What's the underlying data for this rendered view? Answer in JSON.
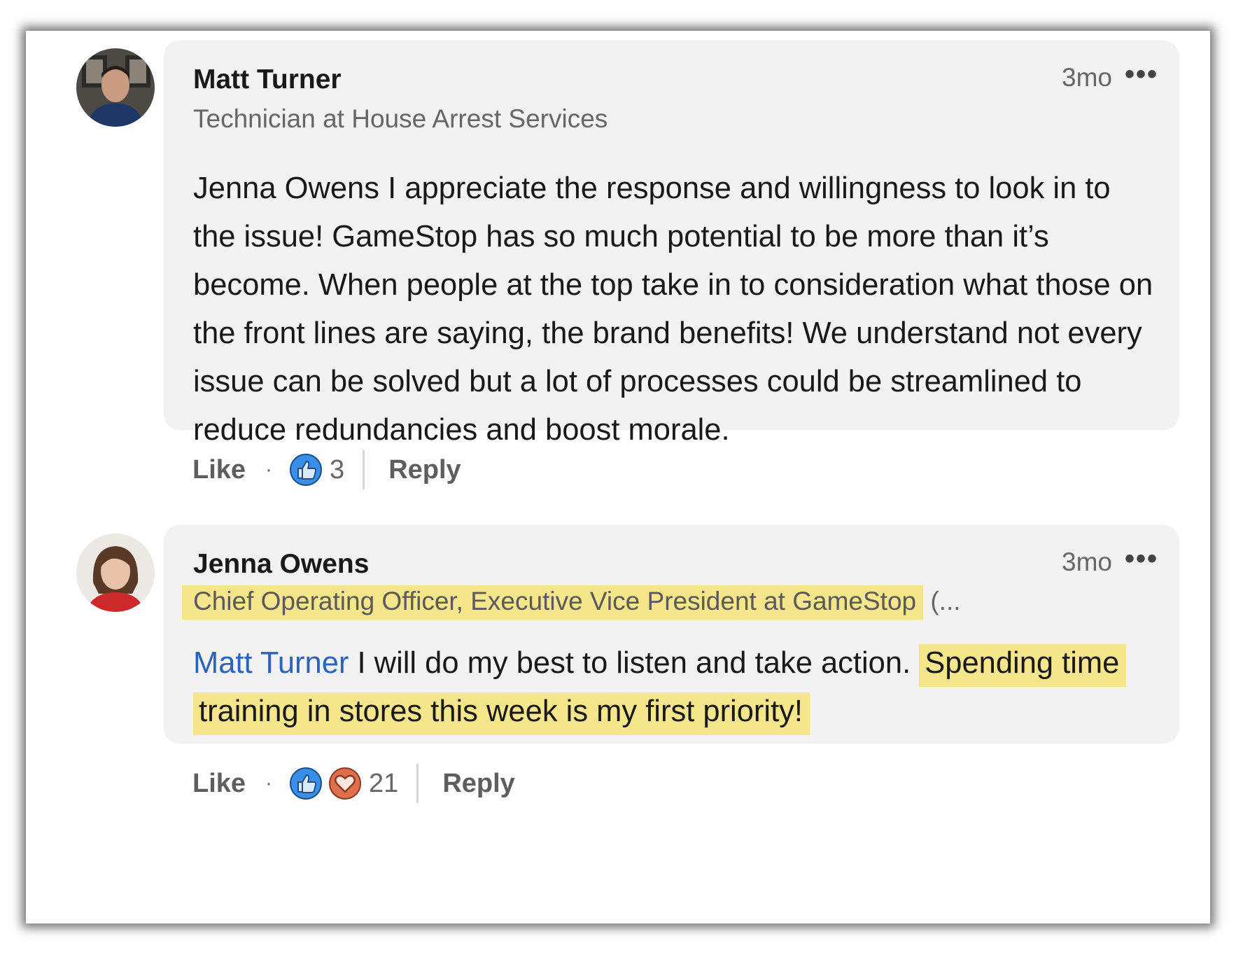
{
  "comments": [
    {
      "author": "Matt Turner",
      "headline": "Technician at House Arrest Services",
      "time": "3mo",
      "more": "•••",
      "body": "Jenna Owens I appreciate the response and willingness to look in to the issue! GameStop has so much potential to be more than it’s become. When people at the top take in to consideration what those on the front lines are saying, the brand benefits! We understand not every issue can be solved but a lot of processes could be streamlined to reduce redundancies and boost morale.",
      "actions": {
        "like_label": "Like",
        "dot": "·",
        "reaction_icons": [
          "thumbs-up-icon"
        ],
        "reaction_count": "3",
        "reply_label": "Reply"
      }
    },
    {
      "author": "Jenna Owens",
      "headline_highlighted": "Chief Operating Officer, Executive Vice President at GameStop",
      "headline_rest": " (...",
      "time": "3mo",
      "more": "•••",
      "mention": "Matt Turner",
      "body_plain": " I will do my best to listen and take action. ",
      "body_highlighted": "Spending time training in stores this week is my first priority!",
      "actions": {
        "like_label": "Like",
        "dot": "·",
        "reaction_icons": [
          "thumbs-up-icon",
          "heart-icon"
        ],
        "reaction_count": "21",
        "reply_label": "Reply"
      }
    }
  ],
  "colors": {
    "bubble": "#f2f2f2",
    "highlight": "#f5e68c",
    "mention": "#2a64bc",
    "like_reaction": "#378fe9",
    "love_reaction": "#df704d"
  }
}
